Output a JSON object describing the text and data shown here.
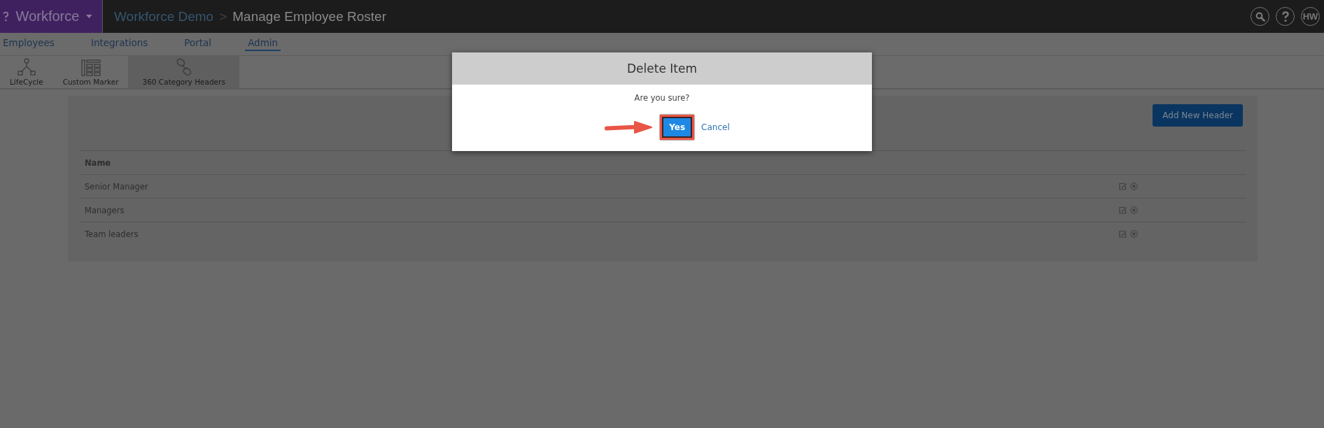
{
  "header": {
    "brand": "Workforce",
    "breadcrumb": [
      {
        "kind": "link",
        "label": "Workforce Demo"
      },
      {
        "kind": "current",
        "label": "Manage Employee Roster"
      }
    ],
    "separator": ">",
    "avatar": "HW"
  },
  "nav": [
    {
      "label": "Employees",
      "selected": false
    },
    {
      "label": "Integrations",
      "selected": false
    },
    {
      "label": "Portal",
      "selected": false
    },
    {
      "label": "Admin",
      "selected": true
    }
  ],
  "toolbar": [
    {
      "kind": "lifecycle",
      "label": "LifeCycle",
      "selected": false
    },
    {
      "kind": "marker",
      "label": "Custom Marker",
      "selected": false
    },
    {
      "kind": "link",
      "label": "360 Category Headers",
      "selected": true
    }
  ],
  "card": {
    "button": "Add New Header",
    "table": {
      "columns": [
        "Name"
      ],
      "rows": [
        {
          "name": "Senior Manager"
        },
        {
          "name": "Managers"
        },
        {
          "name": "Team leaders"
        }
      ]
    }
  },
  "dialog": {
    "title": "Delete Item",
    "message": "Are you sure?",
    "confirm": "Yes",
    "cancel": "Cancel"
  }
}
